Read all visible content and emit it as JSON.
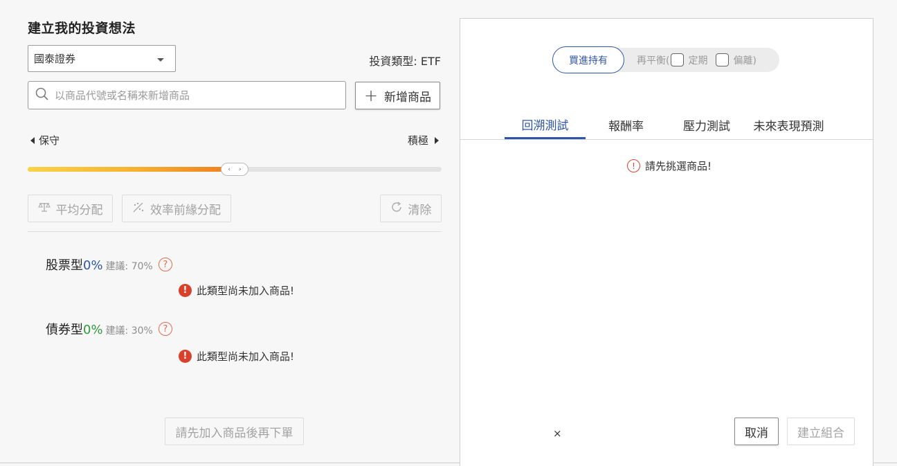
{
  "left_panel": {
    "title": "建立我的投資想法",
    "broker_select": {
      "value": "國泰證券"
    },
    "investment_type": "投資類型: ETF",
    "search": {
      "placeholder": "以商品代號或名稱來新增商品"
    },
    "add_button": "新增商品",
    "risk": {
      "low_label": "保守",
      "high_label": "積極",
      "level_fraction": 0.5
    },
    "tools": {
      "equal": "平均分配",
      "frontier": "效率前緣分配",
      "clear": "清除"
    },
    "categories": [
      {
        "name": "股票型",
        "percent": "0%",
        "suggestion": "建議: 70%",
        "color": "#2f56a6",
        "warning": "此類型尚未加入商品!"
      },
      {
        "name": "債券型",
        "percent": "0%",
        "suggestion": "建議: 30%",
        "color": "#2e9a3a",
        "warning": "此類型尚未加入商品!"
      }
    ],
    "order_button": "請先加入商品後再下單"
  },
  "right_panel": {
    "mode": {
      "buy_hold": "買進持有",
      "rebalance_prefix": "再平衡(",
      "fixed": "定期",
      "deviation": "偏離)"
    },
    "tabs": [
      "回溯測試",
      "報酬率",
      "壓力測試",
      "未來表現預測"
    ],
    "active_tab": 0,
    "hint": "請先挑選商品!",
    "close": "×",
    "cancel_button": "取消",
    "create_button": "建立組合"
  },
  "colors": {
    "accent": "#2f56a6",
    "warning": "#d9412b",
    "slider_start": "#f8d34a",
    "slider_end": "#ee7d1e"
  }
}
